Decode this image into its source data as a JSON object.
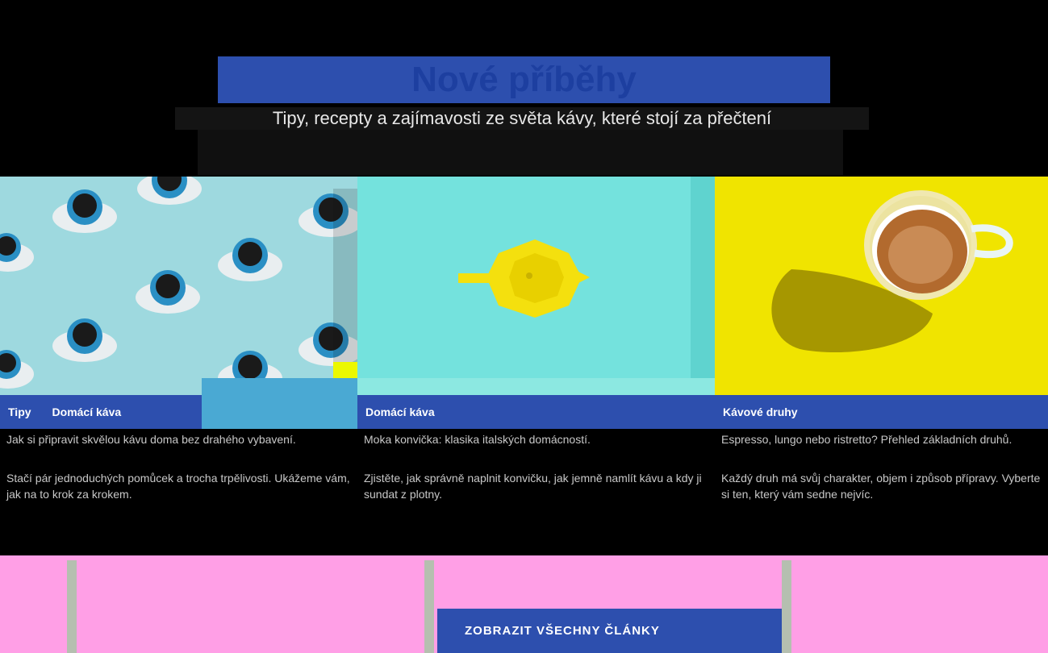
{
  "page": {
    "heading": "Nové příběhy",
    "subtitle": "Tipy, recepty a zajímavosti ze světa kávy, které stojí za přečtení"
  },
  "articles": [
    {
      "tags": [
        "Tipy",
        "Domácí káva"
      ],
      "excerpt_lead": "Jak si připravit skvělou kávu doma bez drahého vybavení.",
      "excerpt_body": "Stačí pár jednoduchých pomůcek a trocha trpělivosti. Ukážeme vám, jak na to krok za krokem."
    },
    {
      "tags": [
        "Domácí káva"
      ],
      "excerpt_lead": "Moka konvička: klasika italských domácností.",
      "excerpt_body": "Zjistěte, jak správně naplnit konvičku, jak jemně namlít kávu a kdy ji sundat z plotny."
    },
    {
      "tags": [
        "Kávové druhy"
      ],
      "excerpt_lead": "Espresso, lungo nebo ristretto? Přehled základních druhů.",
      "excerpt_body": "Každý druh má svůj charakter, objem i způsob přípravy. Vyberte si ten, který vám sedne nejvíc."
    }
  ],
  "cta": {
    "label": "ZOBRAZIT VŠECHNY ČLÁNKY"
  },
  "colors": {
    "accent": "#2d4fae",
    "pink": "#ff9fe6",
    "teal": "#7ee8e1",
    "yellow": "#f2e400"
  }
}
